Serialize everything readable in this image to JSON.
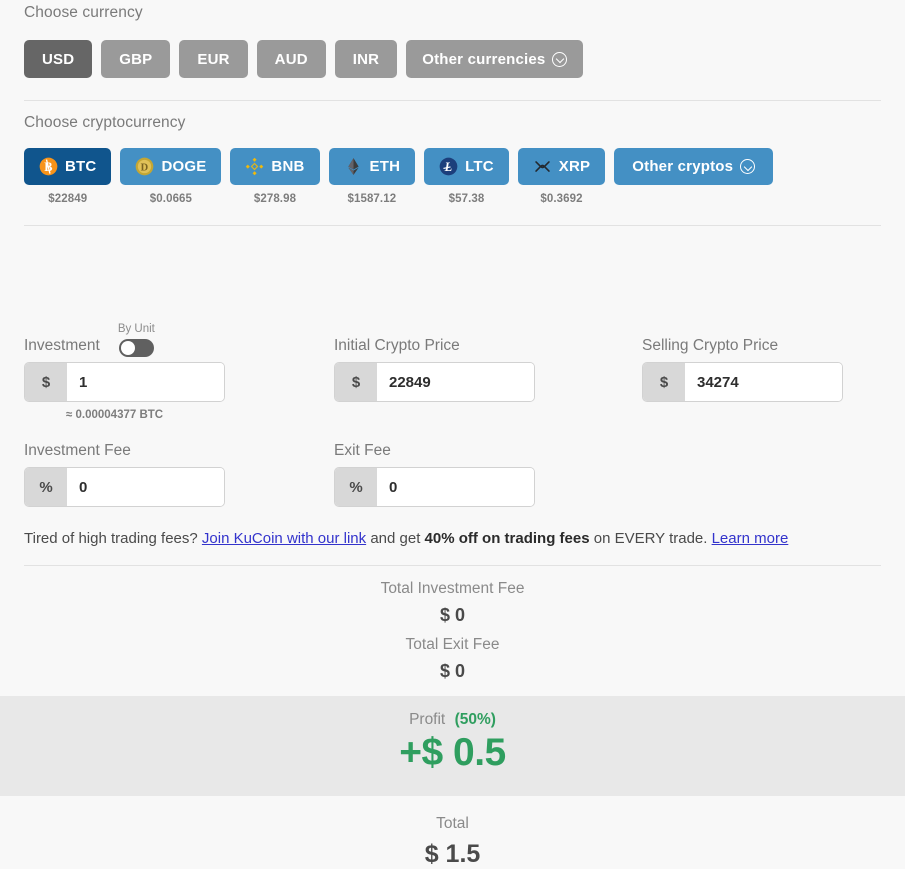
{
  "currency": {
    "label": "Choose currency",
    "options": [
      {
        "code": "USD",
        "selected": true
      },
      {
        "code": "GBP",
        "selected": false
      },
      {
        "code": "EUR",
        "selected": false
      },
      {
        "code": "AUD",
        "selected": false
      },
      {
        "code": "INR",
        "selected": false
      }
    ],
    "other_label": "Other currencies",
    "other_icon": "chevron-down-circle-icon"
  },
  "crypto": {
    "label": "Choose cryptocurrency",
    "options": [
      {
        "code": "BTC",
        "price": "$22849",
        "selected": true,
        "icon": "bitcoin-icon"
      },
      {
        "code": "DOGE",
        "price": "$0.0665",
        "selected": false,
        "icon": "dogecoin-icon"
      },
      {
        "code": "BNB",
        "price": "$278.98",
        "selected": false,
        "icon": "binance-icon"
      },
      {
        "code": "ETH",
        "price": "$1587.12",
        "selected": false,
        "icon": "ethereum-icon"
      },
      {
        "code": "LTC",
        "price": "$57.38",
        "selected": false,
        "icon": "litecoin-icon"
      },
      {
        "code": "XRP",
        "price": "$0.3692",
        "selected": false,
        "icon": "ripple-icon"
      }
    ],
    "other_label": "Other cryptos",
    "other_icon": "chevron-down-circle-icon"
  },
  "form": {
    "investment": {
      "label": "Investment",
      "toggle_caption": "By Unit",
      "toggle_on": false,
      "prefix": "$",
      "value": "1",
      "placeholder": "",
      "note": "≈ 0.00004377 BTC"
    },
    "initial_price": {
      "label": "Initial Crypto Price",
      "prefix": "$",
      "value": "22849",
      "placeholder": ""
    },
    "selling_price": {
      "label": "Selling Crypto Price",
      "prefix": "$",
      "value": "34274",
      "placeholder": ""
    },
    "investment_fee": {
      "label": "Investment Fee",
      "prefix": "%",
      "value": "0",
      "placeholder": ""
    },
    "exit_fee": {
      "label": "Exit Fee",
      "prefix": "%",
      "value": "0",
      "placeholder": ""
    }
  },
  "promo": {
    "text_1": "Tired of high trading fees?",
    "link_1": "Join KuCoin with our link",
    "text_2": "and get",
    "bold": "40% off on trading fees",
    "text_3": "on EVERY trade.",
    "link_2": "Learn more"
  },
  "results": {
    "total_investment_fee_label": "Total Investment Fee",
    "total_investment_fee_value": "$ 0",
    "total_exit_fee_label": "Total Exit Fee",
    "total_exit_fee_value": "$ 0",
    "profit_label": "Profit",
    "profit_percent": "(50%)",
    "profit_amount": "+$ 0.5",
    "total_label": "Total",
    "total_value": "$ 1.5"
  },
  "colors": {
    "page_bg": "#f8f8f8",
    "chip_bg": "#9a9a9a",
    "chip_selected_bg": "#666666",
    "crypto_bg": "#4490c4",
    "crypto_selected_bg": "#10558d",
    "profit_green": "#2f9e5f",
    "link_blue": "#3333cc",
    "profit_band_bg": "#e8e8e8"
  }
}
